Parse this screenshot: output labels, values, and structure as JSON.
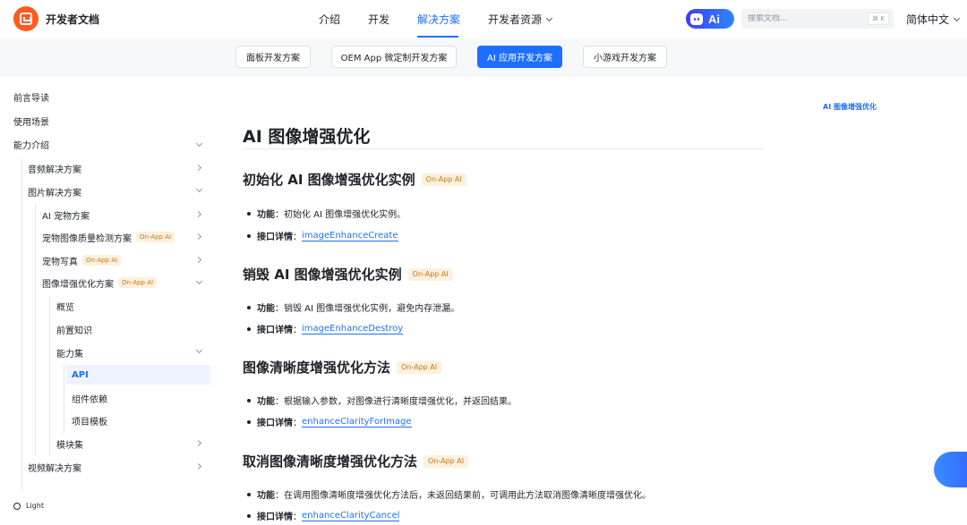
{
  "brand": {
    "name": "开发者文档"
  },
  "nav": {
    "items": [
      {
        "label": "介绍"
      },
      {
        "label": "开发"
      },
      {
        "label": "解决方案"
      },
      {
        "label": "开发者资源"
      }
    ],
    "ai_label": "Ai",
    "search_placeholder": "搜索文档...",
    "search_shortcut": "⌘ K",
    "language": "简体中文"
  },
  "solution_tabs": [
    {
      "label": "面板开发方案"
    },
    {
      "label": "OEM App 微定制开发方案"
    },
    {
      "label": "AI 应用开发方案"
    },
    {
      "label": "小游戏开发方案"
    }
  ],
  "badge_text": "On-App AI",
  "sidebar": {
    "items": [
      {
        "label": "前言导读"
      },
      {
        "label": "使用场景"
      },
      {
        "label": "能力介绍"
      },
      {
        "label": "音频解决方案"
      },
      {
        "label": "图片解决方案"
      },
      {
        "label": "AI 宠物方案"
      },
      {
        "label": "宠物图像质量检测方案"
      },
      {
        "label": "宠物写真"
      },
      {
        "label": "图像增强优化方案"
      },
      {
        "label": "概览"
      },
      {
        "label": "前置知识"
      },
      {
        "label": "能力集"
      },
      {
        "label": "API"
      },
      {
        "label": "组件依赖"
      },
      {
        "label": "项目模板"
      },
      {
        "label": "模块集"
      },
      {
        "label": "视频解决方案"
      }
    ],
    "theme_label": "Light"
  },
  "page": {
    "title": "AI 图像增强优化",
    "sections": [
      {
        "title": "初始化 AI 图像增强优化实例",
        "func_label": "功能",
        "func_text": "：初始化 AI 图像增强优化实例。",
        "api_label": "接口详情",
        "api_sep": "：",
        "api_link": "imageEnhanceCreate"
      },
      {
        "title": "销毁 AI 图像增强优化实例",
        "func_label": "功能",
        "func_text": "：销毁 AI 图像增强优化实例，避免内存泄漏。",
        "api_label": "接口详情",
        "api_sep": "：",
        "api_link": "imageEnhanceDestroy"
      },
      {
        "title": "图像清晰度增强优化方法",
        "func_label": "功能",
        "func_text": "：根据输入参数，对图像进行清晰度增强优化，并返回结果。",
        "api_label": "接口详情",
        "api_sep": "：",
        "api_link": "enhanceClarityForImage"
      },
      {
        "title": "取消图像清晰度增强优化方法",
        "func_label": "功能",
        "func_text": "：在调用图像清晰度增强优化方法后，未返回结果前，可调用此方法取消图像清晰度增强优化。",
        "api_label": "接口详情",
        "api_sep": "：",
        "api_link": "enhanceClarityCancel"
      }
    ]
  },
  "toc": {
    "active": "AI 图像增强优化"
  },
  "colors": {
    "accent": "#1e6fff",
    "brand": "#ff5a1f",
    "badge_bg": "#fdf0dd",
    "badge_text": "#c3781a"
  }
}
